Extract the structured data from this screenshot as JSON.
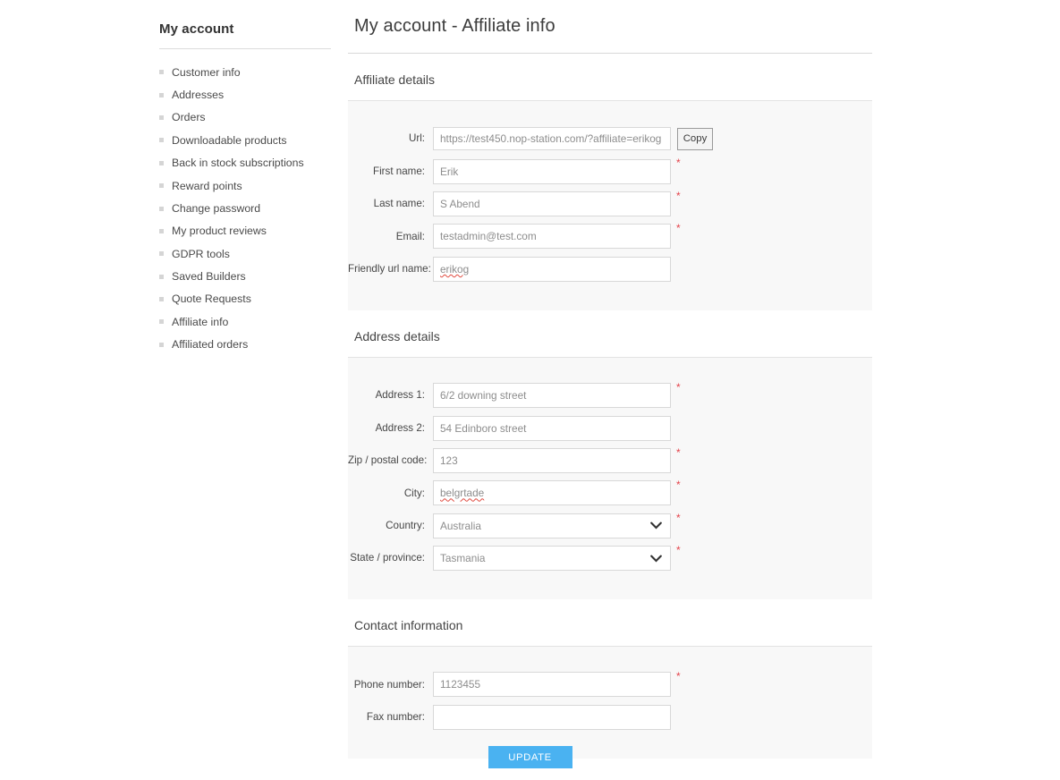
{
  "sidebar": {
    "title": "My account",
    "items": [
      {
        "label": "Customer info"
      },
      {
        "label": "Addresses"
      },
      {
        "label": "Orders"
      },
      {
        "label": "Downloadable products"
      },
      {
        "label": "Back in stock subscriptions"
      },
      {
        "label": "Reward points"
      },
      {
        "label": "Change password"
      },
      {
        "label": "My product reviews"
      },
      {
        "label": "GDPR tools"
      },
      {
        "label": "Saved Builders"
      },
      {
        "label": "Quote Requests"
      },
      {
        "label": "Affiliate info"
      },
      {
        "label": "Affiliated orders"
      }
    ]
  },
  "page": {
    "title": "My account - Affiliate info"
  },
  "affiliate_details": {
    "heading": "Affiliate details",
    "url": {
      "label": "Url:",
      "value": "https://test450.nop-station.com/?affiliate=erikog",
      "copy_label": "Copy"
    },
    "first_name": {
      "label": "First name:",
      "value": "Erik",
      "required": "*"
    },
    "last_name": {
      "label": "Last name:",
      "value": "S Abend",
      "required": "*"
    },
    "email": {
      "label": "Email:",
      "value": "testadmin@test.com",
      "required": "*"
    },
    "friendly_url_name": {
      "label": "Friendly url name:",
      "value": "erikog"
    }
  },
  "address_details": {
    "heading": "Address details",
    "address1": {
      "label": "Address 1:",
      "value": "6/2 downing street",
      "required": "*"
    },
    "address2": {
      "label": "Address 2:",
      "value": "54 Edinboro street"
    },
    "zip": {
      "label": "Zip / postal code:",
      "value": "123",
      "required": "*"
    },
    "city": {
      "label": "City:",
      "value": "belgrtade",
      "required": "*"
    },
    "country": {
      "label": "Country:",
      "value": "Australia",
      "required": "*"
    },
    "state": {
      "label": "State / province:",
      "value": "Tasmania",
      "required": "*"
    }
  },
  "contact_information": {
    "heading": "Contact information",
    "phone": {
      "label": "Phone number:",
      "value": "1123455",
      "required": "*"
    },
    "fax": {
      "label": "Fax number:",
      "value": ""
    }
  },
  "footer": {
    "update_label": "UPDATE"
  },
  "colors": {
    "accent": "#4ab2f1",
    "panel": "#f8f8f8",
    "required": "#e4434b",
    "border": "#d8d8d8"
  }
}
